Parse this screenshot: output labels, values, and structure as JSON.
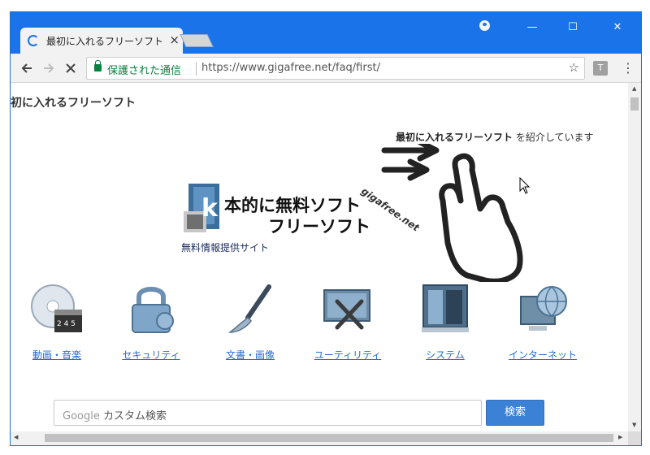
{
  "browser": {
    "tab_title": "最初に入れるフリーソフト",
    "tab_close": "×",
    "secure_label": "保護された通信",
    "url": "https://www.gigafree.net/faq/first/",
    "extension_label": "T"
  },
  "window_controls": {
    "minimize": "—",
    "maximize": "☐",
    "close": "✕"
  },
  "page": {
    "heading": "初に入れるフリーソフト",
    "tagline_bold": "最初に入れるフリーソフト",
    "tagline_rest": " を紹介しています",
    "logo": {
      "line1": "本的に無料ソフト",
      "line2": "フリーソフト",
      "sub": "無料情報提供サイト",
      "site": "gigafree.net"
    },
    "categories": [
      {
        "label": "動画・音楽",
        "icon": "disc-media-icon"
      },
      {
        "label": "セキュリティ",
        "icon": "padlock-icon"
      },
      {
        "label": "文書・画像",
        "icon": "brush-icon"
      },
      {
        "label": "ユーティリティ",
        "icon": "tools-icon"
      },
      {
        "label": "システム",
        "icon": "computer-tower-icon"
      },
      {
        "label": "インターネット",
        "icon": "globe-monitor-icon"
      }
    ],
    "search": {
      "google_label": "Google",
      "placeholder": "カスタム検索",
      "button": "検索"
    }
  }
}
